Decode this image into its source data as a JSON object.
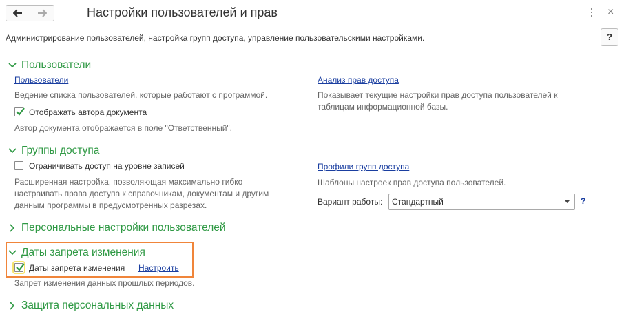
{
  "header": {
    "title": "Настройки пользователей и прав",
    "description": "Администрирование пользователей, настройка групп доступа, управление пользовательскими настройками.",
    "help_label": "?",
    "close_label": "×"
  },
  "sections": {
    "users": {
      "title": "Пользователи",
      "link": "Пользователи",
      "link_desc": "Ведение списка пользователей, которые работают с программой.",
      "checkbox_label": "Отображать автора документа",
      "checkbox_desc": "Автор документа отображается в поле \"Ответственный\".",
      "rights_link": "Анализ прав доступа",
      "rights_desc_1": "Показывает текущие настройки прав доступа пользователей к",
      "rights_desc_2": "таблицам информационной базы."
    },
    "groups": {
      "title": "Группы доступа",
      "checkbox_label": "Ограничивать доступ на уровне записей",
      "desc_1": "Расширенная настройка, позволяющая максимально гибко",
      "desc_2": "настраивать права доступа к справочникам, документам и другим",
      "desc_3": "данным программы в предусмотренных разрезах.",
      "profiles_link": "Профили групп доступа",
      "profiles_desc": "Шаблоны настроек прав доступа пользователей.",
      "mode_label": "Вариант работы:",
      "mode_value": "Стандартный",
      "mode_help": "?"
    },
    "personal": {
      "title": "Персональные настройки пользователей"
    },
    "dates": {
      "title": "Даты запрета изменения",
      "checkbox_label": "Даты запрета изменения",
      "configure_link": "Настроить",
      "desc": "Запрет изменения данных прошлых периодов."
    },
    "protection": {
      "title": "Защита персональных данных"
    }
  },
  "colors": {
    "section_green": "#2f9944",
    "link_blue": "#1a3ea0",
    "highlight_orange": "#f0853a"
  }
}
